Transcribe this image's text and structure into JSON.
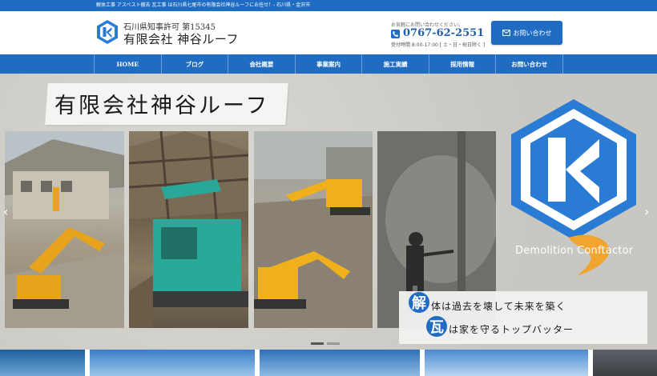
{
  "topbar": {
    "text": "解体工事 アスベスト撤去 瓦工事 は石川県七尾市の有限会社神谷ルーフにお任せ！- 石川県・金沢市"
  },
  "header": {
    "license": "石川県知事許可 第15345",
    "company": "有限会社 神谷ルーフ",
    "contact_lead": "お気軽にお問い合わせください。",
    "phone": "0767-62-2551",
    "hours": "受付時間 8:00-17:00 [ 土・日・祝日除く ]",
    "inquiry_button": "お問い合わせ"
  },
  "nav": {
    "items": [
      {
        "label": "HOME"
      },
      {
        "label": "ブログ"
      },
      {
        "label": "会社概要"
      },
      {
        "label": "事業案内"
      },
      {
        "label": "施工実績"
      },
      {
        "label": "採用情報"
      },
      {
        "label": "お問い合わせ"
      }
    ]
  },
  "hero": {
    "title": "有限会社神谷ルーフ",
    "logo_caption": "Demolition Conftactor",
    "slogan": {
      "kanji1": "解",
      "line1": "体は過去を壊して未来を築く",
      "kanji2": "瓦",
      "line2": "は家を守るトップバッター"
    },
    "arrow_prev": "‹",
    "arrow_next": "›"
  },
  "icons": {
    "logo": "k-hexagon-logo-icon",
    "phone": "phone-icon",
    "mail": "mail-icon"
  },
  "colors": {
    "brand_blue": "#1f6cc2",
    "logo_blue": "#2a7bd3",
    "accent_orange": "#f2a431"
  }
}
